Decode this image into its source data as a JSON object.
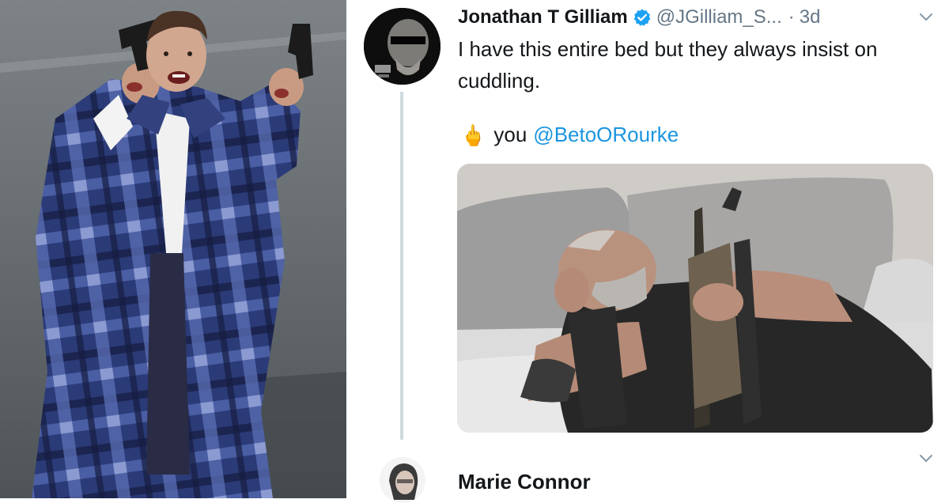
{
  "tweet": {
    "author_name": "Jonathan T Gilliam",
    "handle": "@JGilliam_S...",
    "separator": "·",
    "time": "3d",
    "text": "I have this entire bed but they always insist on cuddling.",
    "reply_prefix": "you",
    "reply_mention": "@BetoORourke",
    "verified": true,
    "icons": {
      "verified": "verified-badge-icon",
      "menu": "chevron-down-icon",
      "emoji": "middle-finger-emoji-icon"
    }
  },
  "next_reply": {
    "author_name": "Marie Connor",
    "icons": {
      "menu": "chevron-down-icon"
    }
  },
  "colors": {
    "link": "#1b95e0",
    "verified": "#1da1f2",
    "muted": "#657786",
    "thread_line": "#cfd9de"
  }
}
